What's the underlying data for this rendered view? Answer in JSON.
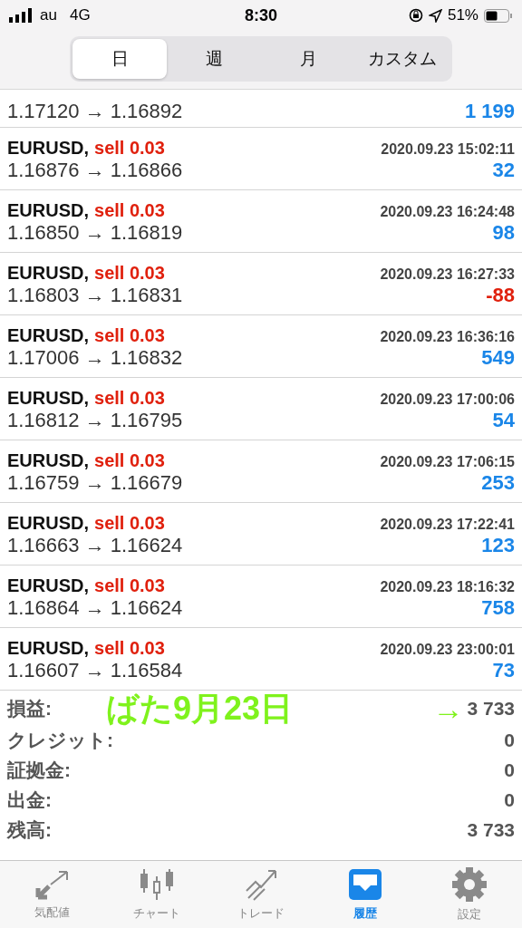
{
  "status_bar": {
    "carrier": "au",
    "network": "4G",
    "time": "8:30",
    "battery": "51%"
  },
  "segments": [
    {
      "label": "日",
      "selected": true
    },
    {
      "label": "週",
      "selected": false
    },
    {
      "label": "月",
      "selected": false
    },
    {
      "label": "カスタム",
      "selected": false
    }
  ],
  "partial_trade": {
    "prices": "1.17120 → 1.16892",
    "profit": "1 199",
    "loss": false
  },
  "trades": [
    {
      "symbol": "EURUSD,",
      "side": "sell 0.03",
      "time": "2020.09.23 15:02:11",
      "prices": "1.16876 → 1.16866",
      "profit": "32",
      "loss": false
    },
    {
      "symbol": "EURUSD,",
      "side": "sell 0.03",
      "time": "2020.09.23 16:24:48",
      "prices": "1.16850 → 1.16819",
      "profit": "98",
      "loss": false
    },
    {
      "symbol": "EURUSD,",
      "side": "sell 0.03",
      "time": "2020.09.23 16:27:33",
      "prices": "1.16803 → 1.16831",
      "profit": "-88",
      "loss": true
    },
    {
      "symbol": "EURUSD,",
      "side": "sell 0.03",
      "time": "2020.09.23 16:36:16",
      "prices": "1.17006 → 1.16832",
      "profit": "549",
      "loss": false
    },
    {
      "symbol": "EURUSD,",
      "side": "sell 0.03",
      "time": "2020.09.23 17:00:06",
      "prices": "1.16812 → 1.16795",
      "profit": "54",
      "loss": false
    },
    {
      "symbol": "EURUSD,",
      "side": "sell 0.03",
      "time": "2020.09.23 17:06:15",
      "prices": "1.16759 → 1.16679",
      "profit": "253",
      "loss": false
    },
    {
      "symbol": "EURUSD,",
      "side": "sell 0.03",
      "time": "2020.09.23 17:22:41",
      "prices": "1.16663 → 1.16624",
      "profit": "123",
      "loss": false
    },
    {
      "symbol": "EURUSD,",
      "side": "sell 0.03",
      "time": "2020.09.23 18:16:32",
      "prices": "1.16864 → 1.16624",
      "profit": "758",
      "loss": false
    },
    {
      "symbol": "EURUSD,",
      "side": "sell 0.03",
      "time": "2020.09.23 23:00:01",
      "prices": "1.16607 → 1.16584",
      "profit": "73",
      "loss": false
    }
  ],
  "summary": [
    {
      "label": "損益:",
      "value": "3 733"
    },
    {
      "label": "クレジット:",
      "value": "0"
    },
    {
      "label": "証拠金:",
      "value": "0"
    },
    {
      "label": "出金:",
      "value": "0"
    },
    {
      "label": "残高:",
      "value": "3 733"
    }
  ],
  "annotation": {
    "text": "ばた9月23日",
    "arrow": "→"
  },
  "tab_bar": [
    {
      "label": "気配値",
      "kind": "arrows",
      "selected": false
    },
    {
      "label": "チャート",
      "kind": "candles",
      "selected": false
    },
    {
      "label": "トレード",
      "kind": "trend",
      "selected": false
    },
    {
      "label": "履歴",
      "kind": "inbox",
      "selected": true
    },
    {
      "label": "設定",
      "kind": "gear",
      "selected": false
    }
  ]
}
